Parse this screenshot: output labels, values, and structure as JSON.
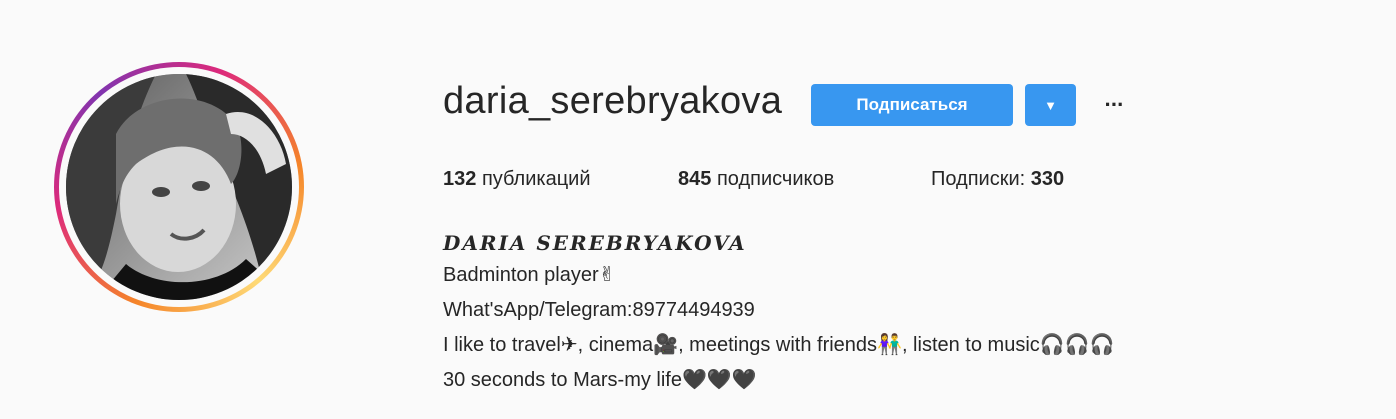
{
  "profile": {
    "username": "daria_serebryakova",
    "follow_label": "Подписаться",
    "dropdown_icon": "▼",
    "more_icon": "···"
  },
  "stats": {
    "posts_count": "132",
    "posts_label": "публикаций",
    "followers_count": "845",
    "followers_label": "подписчиков",
    "following_label": "Подписки:",
    "following_count": "330"
  },
  "bio": {
    "name": "DARIA SEREBRYAKOVA",
    "lines": [
      "Badminton player✌",
      "What'sApp/Telegram:89774494939",
      "I like to travel✈, cinema🎥, meetings with friends👫, listen to music🎧🎧🎧",
      "30 seconds to Mars-my life🖤🖤🖤"
    ]
  },
  "colors": {
    "accent": "#3897f0",
    "text": "#262626",
    "background": "#fafafa"
  }
}
